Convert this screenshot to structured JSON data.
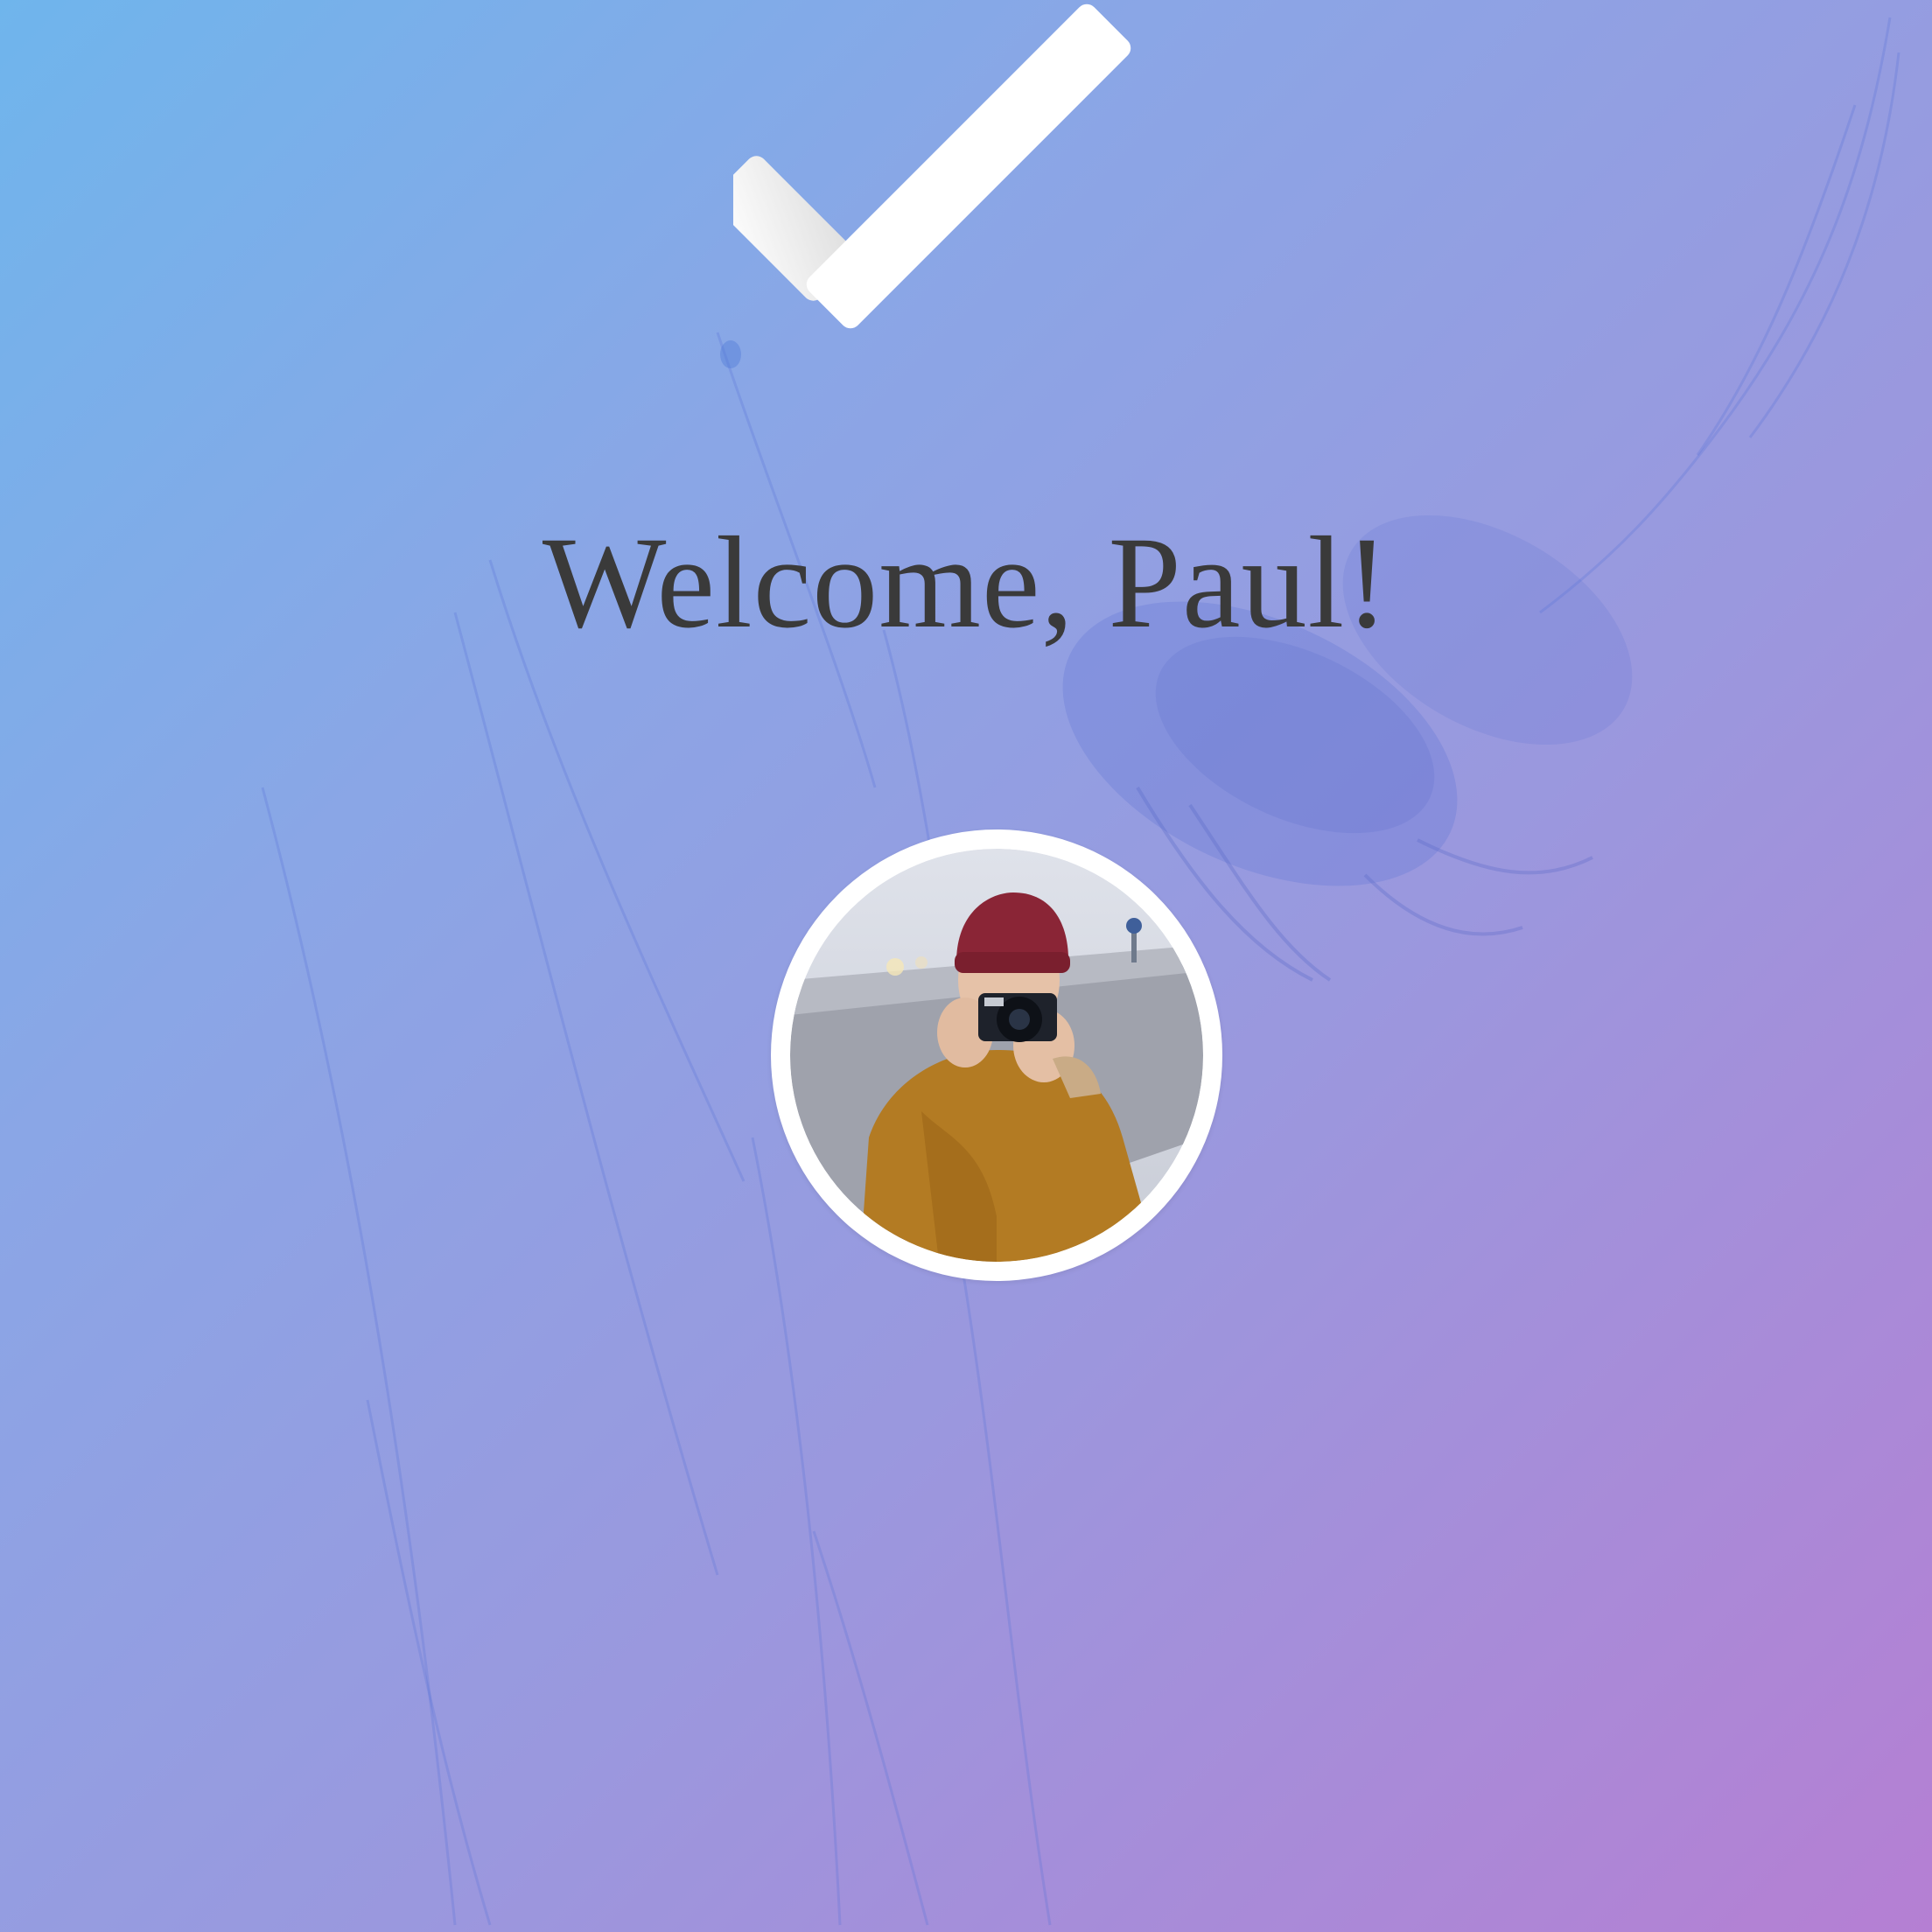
{
  "welcome": {
    "heading": "Welcome, Paul!"
  },
  "icons": {
    "success": "checkmark-icon",
    "avatar": "user-avatar-photo"
  },
  "colors": {
    "gradient_start": "#6fb5ec",
    "gradient_end": "#b57fd3",
    "heading_text": "#3a3a3a",
    "check_fill": "#ffffff",
    "avatar_ring": "#ffffff"
  }
}
